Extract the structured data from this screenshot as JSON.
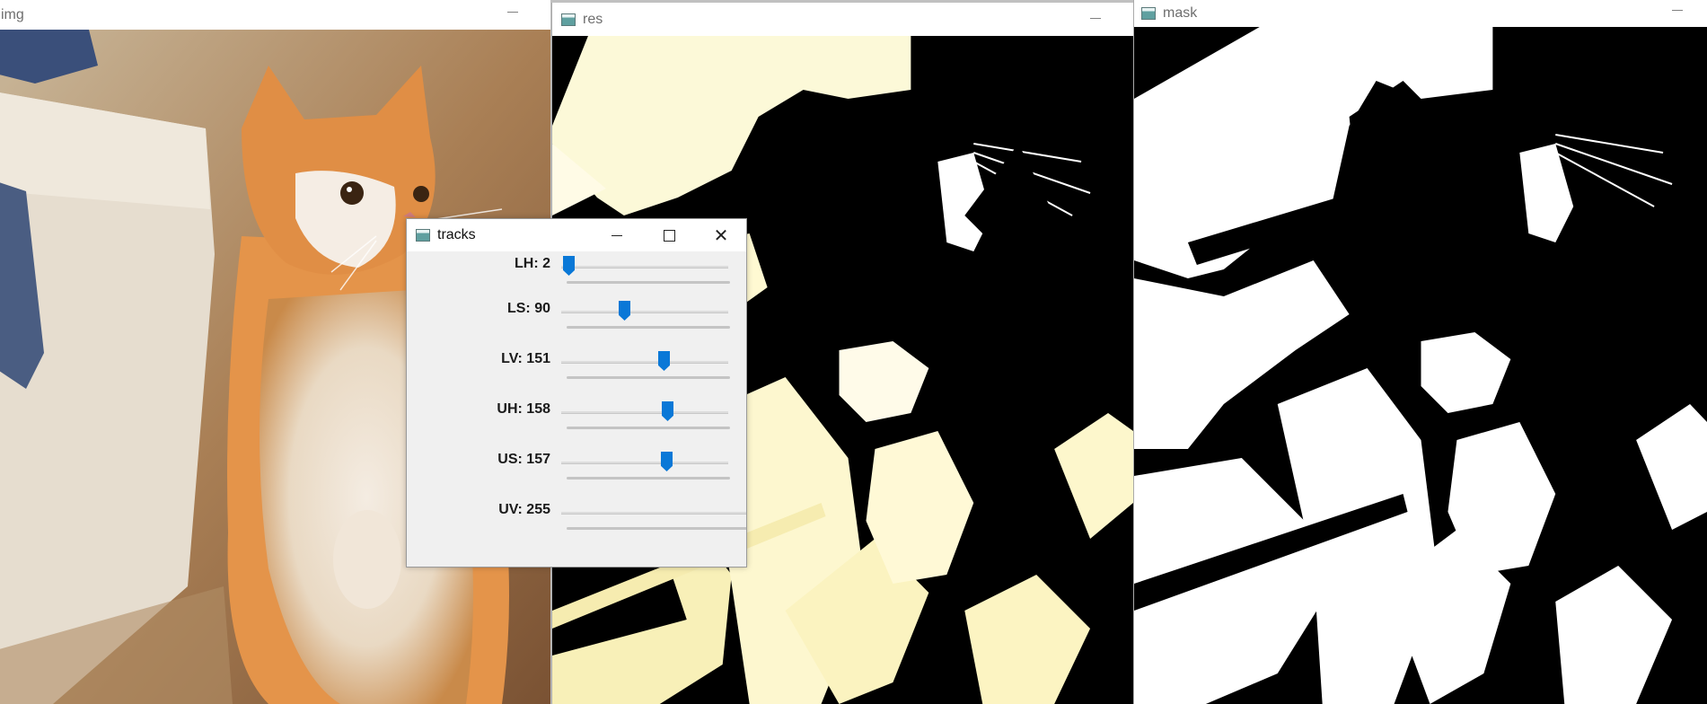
{
  "windows": {
    "img": {
      "title": "img"
    },
    "res": {
      "title": "res"
    },
    "mask": {
      "title": "mask"
    },
    "tracks": {
      "title": "tracks",
      "controls": {
        "minimize": "—",
        "maximize": "☐",
        "close": "✕"
      },
      "trackbars": [
        {
          "label": "LH: 2",
          "value": 2,
          "max": 180
        },
        {
          "label": "LS: 90",
          "value": 90,
          "max": 255
        },
        {
          "label": "LV: 151",
          "value": 151,
          "max": 255
        },
        {
          "label": "UH: 158",
          "value": 158,
          "max": 255
        },
        {
          "label": "US: 157",
          "value": 157,
          "max": 255
        },
        {
          "label": "UV: 255",
          "value": 255,
          "max": 255
        }
      ]
    }
  },
  "colors": {
    "thumb": "#0a78d7",
    "res_highlight": "#fbf6c8",
    "mask_white": "#ffffff",
    "mask_black": "#000000"
  },
  "icons": {
    "window_app_icon": "opencv-window-icon",
    "minimize": "minimize-icon",
    "maximize": "maximize-icon",
    "close": "close-icon"
  }
}
